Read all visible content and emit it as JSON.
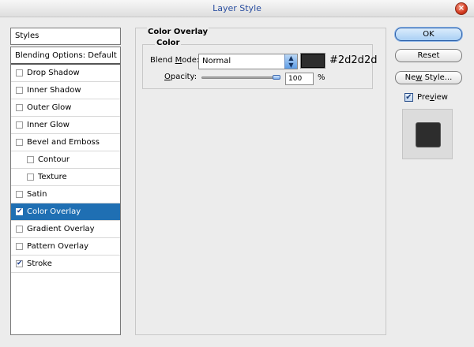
{
  "window": {
    "title": "Layer Style",
    "close_glyph": "×"
  },
  "styles_panel": {
    "header": "Styles",
    "items": [
      {
        "label": "Blending Options: Default",
        "checkbox": false,
        "checked": false,
        "selected": false,
        "indent": false
      },
      {
        "label": "Drop Shadow",
        "checkbox": true,
        "checked": false,
        "selected": false,
        "indent": false
      },
      {
        "label": "Inner Shadow",
        "checkbox": true,
        "checked": false,
        "selected": false,
        "indent": false
      },
      {
        "label": "Outer Glow",
        "checkbox": true,
        "checked": false,
        "selected": false,
        "indent": false
      },
      {
        "label": "Inner Glow",
        "checkbox": true,
        "checked": false,
        "selected": false,
        "indent": false
      },
      {
        "label": "Bevel and Emboss",
        "checkbox": true,
        "checked": false,
        "selected": false,
        "indent": false
      },
      {
        "label": "Contour",
        "checkbox": true,
        "checked": false,
        "selected": false,
        "indent": true
      },
      {
        "label": "Texture",
        "checkbox": true,
        "checked": false,
        "selected": false,
        "indent": true
      },
      {
        "label": "Satin",
        "checkbox": true,
        "checked": false,
        "selected": false,
        "indent": false
      },
      {
        "label": "Color Overlay",
        "checkbox": true,
        "checked": true,
        "selected": true,
        "indent": false
      },
      {
        "label": "Gradient Overlay",
        "checkbox": true,
        "checked": false,
        "selected": false,
        "indent": false
      },
      {
        "label": "Pattern Overlay",
        "checkbox": true,
        "checked": false,
        "selected": false,
        "indent": false
      },
      {
        "label": "Stroke",
        "checkbox": true,
        "checked": true,
        "selected": false,
        "indent": false
      }
    ]
  },
  "color_overlay": {
    "section_title": "Color Overlay",
    "group_title": "Color",
    "blend_mode": {
      "label_pre": "Blend ",
      "label_u": "M",
      "label_post": "ode:",
      "value": "Normal"
    },
    "color_hex": "#2d2d2d",
    "color_label": "#2d2d2d",
    "opacity": {
      "label_u": "O",
      "label_post": "pacity:",
      "value": "100",
      "unit": "%",
      "level": 1.0
    }
  },
  "buttons": {
    "ok": "OK",
    "reset": "Reset",
    "new_style_pre": "Ne",
    "new_style_u": "w",
    "new_style_post": " Style..."
  },
  "preview": {
    "checked": true,
    "label_pre": "Pre",
    "label_u": "v",
    "label_post": "iew",
    "swatch_color": "#2d2d2d"
  },
  "colors": {
    "selection": "#1f6fb3",
    "title_text": "#2a4ea0"
  }
}
